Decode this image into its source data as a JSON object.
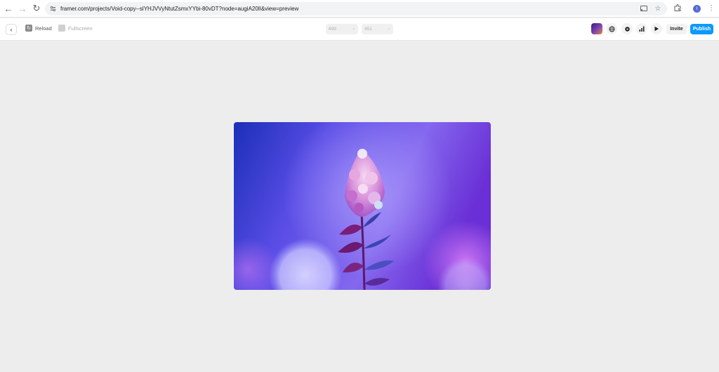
{
  "browser": {
    "url": "framer.com/projects/Void-copy--slYHJVVyNtutZsmxYYbi-80vDT?node=augiA20lI&view=preview",
    "profile_initial": "I"
  },
  "toolbar": {
    "reload_label": "Reload",
    "fullscreen_label": "Fullscreen",
    "width_value": "699",
    "height_value": "451",
    "invite_label": "Invite",
    "publish_label": "Publish"
  },
  "colors": {
    "publish": "#0d99ff",
    "canvas_bg": "#ededed"
  },
  "icons": [
    "back-icon",
    "forward-icon",
    "reload-icon",
    "site-info-icon",
    "cast-icon",
    "star-icon",
    "extensions-icon",
    "kebab-menu-icon",
    "globe-icon",
    "gear-icon",
    "analytics-icon",
    "play-icon"
  ]
}
